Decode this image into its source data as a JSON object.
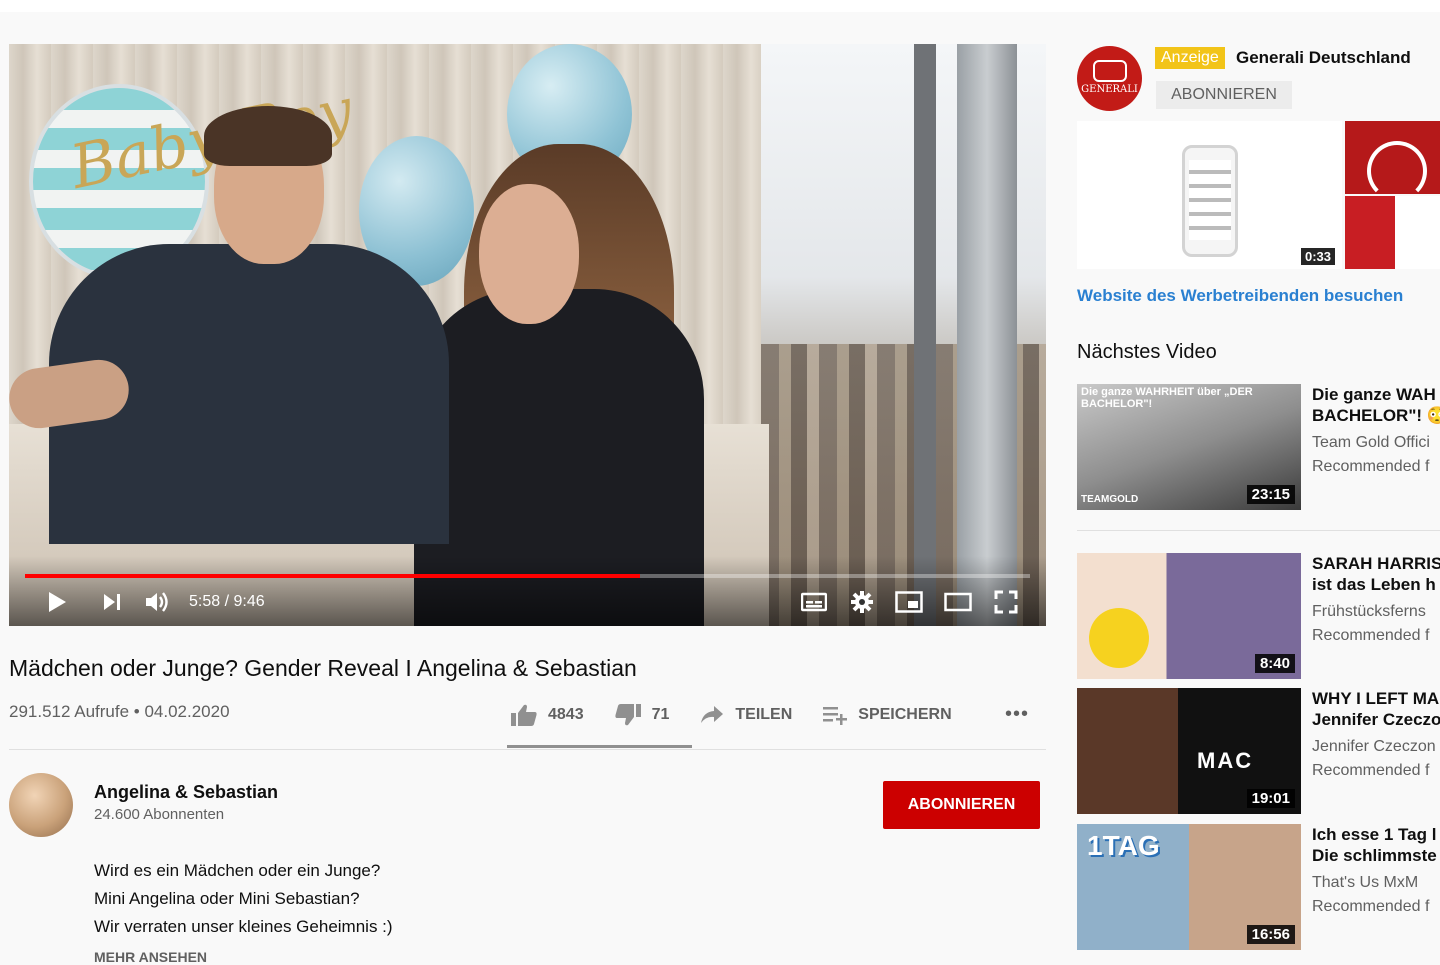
{
  "player": {
    "time_current": "5:58",
    "time_total": "9:46",
    "progress": 0.612,
    "balloon_text": "Baby Boy"
  },
  "video": {
    "title": "Mädchen oder Junge? Gender Reveal I Angelina & Sebastian",
    "meta": "291.512 Aufrufe • 04.02.2020",
    "likes": "4843",
    "dislikes": "71",
    "share_label": "TEILEN",
    "save_label": "SPEICHERN"
  },
  "channel": {
    "name": "Angelina & Sebastian",
    "subscribers": "24.600 Abonnenten",
    "subscribe_label": "ABONNIEREN",
    "description": [
      "Wird es ein Mädchen oder ein Junge?",
      "Mini Angelina oder Mini Sebastian?",
      "Wir verraten unser kleines Geheimnis :)"
    ],
    "show_more": "MEHR ANSEHEN"
  },
  "ad": {
    "badge": "Anzeige",
    "advertiser": "Generali Deutschland",
    "logo_text": "GENERALI",
    "subscribe_label": "ABONNIEREN",
    "duration": "0:33",
    "link": "Website des Werbetreibenden besuchen",
    "accent_color": "#f2c418",
    "brand_color": "#c21b17"
  },
  "up_next": {
    "heading": "Nächstes Video",
    "items": [
      {
        "title_line1": "Die ganze WAH",
        "title_line2": "BACHELOR\"! 😳",
        "channel": "Team Gold Offici",
        "meta": "Recommended f",
        "duration": "23:15",
        "thumb_caption": "Die ganze WAHRHEIT über „DER BACHELOR\"!",
        "thumb_brand": "TEAMGOLD"
      },
      {
        "title_line1": "SARAH HARRIS",
        "title_line2": "ist das Leben h",
        "channel": "Frühstücksferns",
        "meta": "Recommended f",
        "duration": "8:40"
      },
      {
        "title_line1": "WHY I LEFT MA",
        "title_line2": "Jennifer Czeczo",
        "channel": "Jennifer Czeczon",
        "meta": "Recommended f",
        "duration": "19:01",
        "thumb_caption": "MAC"
      },
      {
        "title_line1": "Ich esse 1 Tag l",
        "title_line2": "Die schlimmste",
        "channel": "That's Us MxM",
        "meta": "Recommended f",
        "duration": "16:56",
        "thumb_caption": "1TAG"
      }
    ]
  }
}
